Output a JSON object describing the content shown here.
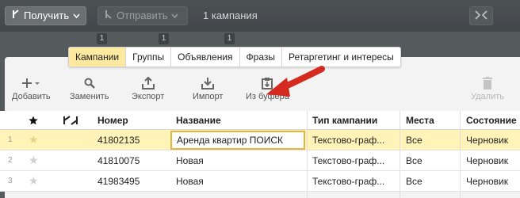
{
  "topbar": {
    "receive_label": "Получить",
    "send_label": "Отправить",
    "campaign_count": "1 кампания"
  },
  "badges": [
    "1",
    "1",
    "1"
  ],
  "tabs": [
    {
      "label": "Кампании",
      "active": true
    },
    {
      "label": "Группы",
      "active": false
    },
    {
      "label": "Объявления",
      "active": false
    },
    {
      "label": "Фразы",
      "active": false
    },
    {
      "label": "Ретаргетинг и интересы",
      "active": false
    }
  ],
  "toolbar": {
    "add_label": "Добавить",
    "replace_label": "Заменить",
    "export_label": "Экспорт",
    "import_label": "Импорт",
    "clipboard_label": "Из буфера",
    "delete_label": "Удалить"
  },
  "table": {
    "headers": {
      "number": "Номер",
      "name": "Название",
      "type": "Тип кампании",
      "places": "Места",
      "state": "Состояние"
    },
    "rows": [
      {
        "index": "1",
        "number": "41802135",
        "name": "Аренда квартир ПОИСК",
        "type": "Текстово-граф...",
        "places": "Все",
        "state": "Черновик"
      },
      {
        "index": "2",
        "number": "41810075",
        "name": "Новая",
        "type": "Текстово-граф...",
        "places": "Все",
        "state": "Черновик"
      },
      {
        "index": "3",
        "number": "41983495",
        "name": "Новая",
        "type": "Текстово-граф...",
        "places": "Все",
        "state": "Черновик"
      }
    ]
  },
  "colors": {
    "active_tab": "#fdeaa0",
    "selected_row": "#fff3b8",
    "edit_border": "#e6b53e",
    "arrow": "#d42a20"
  }
}
